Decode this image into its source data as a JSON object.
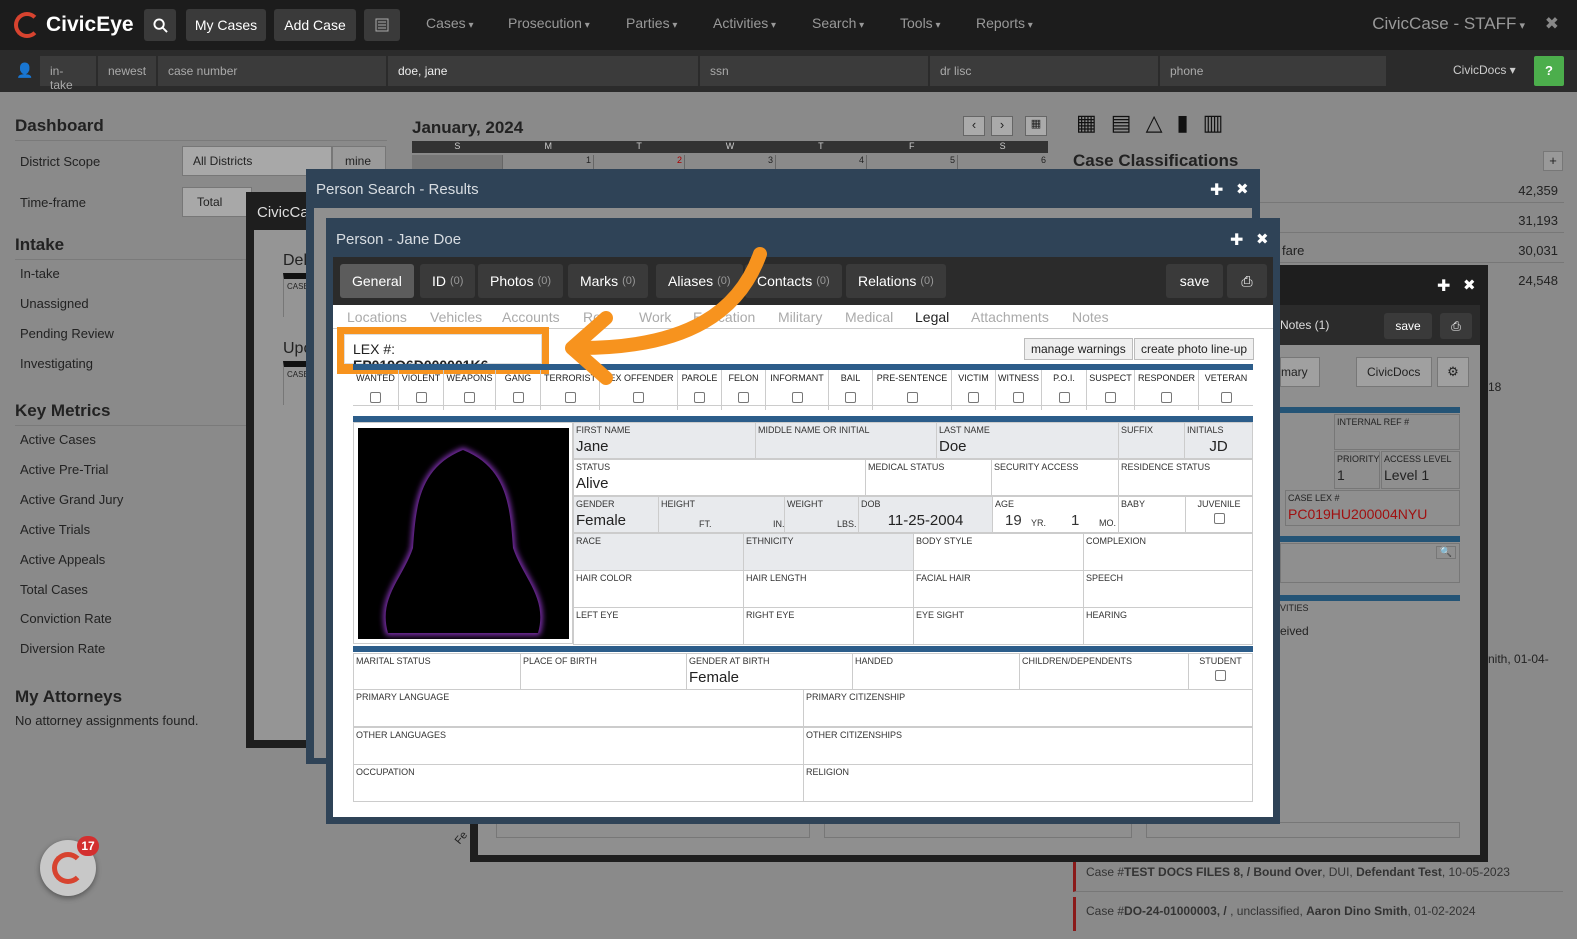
{
  "app": {
    "logo_text": "CivicEye",
    "name": "CivicCase - STAFF"
  },
  "toolbar": {
    "my_cases": "My Cases",
    "add_case": "Add Case"
  },
  "nav": [
    "Cases",
    "Prosecution",
    "Parties",
    "Activities",
    "Search",
    "Tools",
    "Reports"
  ],
  "searchbar": {
    "intake": "in-take",
    "newest": "newest",
    "case_number": "case number",
    "name": "doe, jane",
    "ssn": "ssn",
    "dr": "dr lisc",
    "phone": "phone",
    "civicdocs": "CivicDocs",
    "help": "?"
  },
  "dashboard": {
    "title": "Dashboard",
    "district_label": "District Scope",
    "district_value": "All Districts",
    "mine": "mine",
    "timeframe_label": "Time-frame",
    "timeframe_value": "Total",
    "intake_title": "Intake",
    "intake_items": [
      "In-take",
      "Unassigned",
      "Pending Review",
      "Investigating"
    ],
    "metrics_title": "Key Metrics",
    "metrics_items": [
      "Active Cases",
      "Active Pre-Trial",
      "Active Grand Jury",
      "Active Trials",
      "Active Appeals",
      "Total Cases",
      "Conviction Rate",
      "Diversion Rate"
    ],
    "attorneys_title": "My Attorneys",
    "attorneys_empty": "No attorney assignments found."
  },
  "calendar": {
    "title": "January, 2024",
    "days": [
      "S",
      "M",
      "T",
      "W",
      "T",
      "F",
      "S"
    ],
    "dates": [
      "",
      "1",
      "2",
      "3",
      "4",
      "5",
      "6"
    ]
  },
  "classifications": {
    "title": "Case Classifications",
    "rows": [
      {
        "label": "",
        "value": "42,359"
      },
      {
        "label": "",
        "value": "31,193"
      },
      {
        "label": "fare",
        "value": "30,031"
      },
      {
        "label": "",
        "value": "24,548"
      }
    ]
  },
  "case_list": [
    {
      "prefix": "Case #",
      "bold1": "TEST DOCS FILES 8, / Bound Over",
      "mid": ", DUI, ",
      "bold2": "Defendant Test",
      "tail": ", 10-05-2023"
    },
    {
      "prefix": "Case #",
      "bold1": "DO-24-01000003, /",
      "mid": " , unclassified, ",
      "bold2": "Aaron Dino Smith",
      "tail": ", 01-02-2024"
    }
  ],
  "bg_modal": {
    "title": "CivicCa",
    "del": "Del",
    "upc": "Upc",
    "case": "CASE",
    "notes_tab": "Notes (1)",
    "save": "save",
    "summary": "mary",
    "civicdocs": "CivicDocs",
    "internal_ref": "INTERNAL REF #",
    "priority": "PRIORITY",
    "priority_val": "1",
    "access": "ACCESS LEVEL",
    "access_val": "Level 1",
    "case_lex": "CASE LEX #",
    "case_lex_val": "PC019HU200004NYU",
    "activities": "VITIES",
    "received": "eived",
    "side1": "18",
    "side2": "nith, 01-04-",
    "side3": "Fe"
  },
  "search_results": {
    "title": "Person Search - Results"
  },
  "person": {
    "title": "Person - Jane Doe",
    "tabs": [
      {
        "label": "General",
        "count": ""
      },
      {
        "label": "ID",
        "count": "(0)"
      },
      {
        "label": "Photos",
        "count": "(0)"
      },
      {
        "label": "Marks",
        "count": "(0)"
      },
      {
        "label": "Aliases",
        "count": "(0)"
      },
      {
        "label": "Contacts",
        "count": "(0)"
      },
      {
        "label": "Relations",
        "count": "(0)"
      }
    ],
    "save": "save",
    "subtabs": [
      "Locations",
      "Vehicles",
      "Accounts",
      "Ro",
      "Work",
      "Education",
      "Military",
      "Medical",
      "Legal",
      "Attachments",
      "Notes"
    ],
    "lex_label": "LEX #:",
    "lex_value": "EP019O6D000001K6",
    "manage_warnings": "manage warnings",
    "photo_lineup": "create photo line-up",
    "flags": [
      "WANTED",
      "VIOLENT",
      "WEAPONS",
      "GANG",
      "TERRORIST",
      "SEX OFFENDER",
      "PAROLE",
      "FELON",
      "INFORMANT",
      "BAIL",
      "PRE-SENTENCE",
      "VICTIM",
      "WITNESS",
      "P.O.I.",
      "SUSPECT",
      "RESPONDER",
      "VETERAN"
    ],
    "fields": {
      "first_name_label": "FIRST NAME",
      "first_name": "Jane",
      "middle_label": "MIDDLE NAME OR INITIAL",
      "last_name_label": "LAST NAME",
      "last_name": "Doe",
      "suffix_label": "SUFFIX",
      "initials_label": "INITIALS",
      "initials": "JD",
      "status_label": "STATUS",
      "status": "Alive",
      "medical_label": "MEDICAL STATUS",
      "security_label": "SECURITY ACCESS",
      "residence_label": "RESIDENCE STATUS",
      "gender_label": "GENDER",
      "gender": "Female",
      "height_label": "HEIGHT",
      "ft": "FT.",
      "in": "IN.",
      "weight_label": "WEIGHT",
      "lbs": "LBS.",
      "dob_label": "DOB",
      "dob": "11-25-2004",
      "age_label": "AGE",
      "age_yr": "19",
      "yr": "YR.",
      "age_mo": "1",
      "mo": "MO.",
      "baby_label": "BABY",
      "juvenile_label": "JUVENILE",
      "race_label": "RACE",
      "ethnicity_label": "ETHNICITY",
      "body_label": "BODY STYLE",
      "complexion_label": "COMPLEXION",
      "hair_color_label": "HAIR COLOR",
      "hair_length_label": "HAIR LENGTH",
      "facial_hair_label": "FACIAL HAIR",
      "speech_label": "SPEECH",
      "left_eye_label": "LEFT EYE",
      "right_eye_label": "RIGHT EYE",
      "eye_sight_label": "EYE SIGHT",
      "hearing_label": "HEARING",
      "marital_label": "MARITAL STATUS",
      "birthplace_label": "PLACE OF BIRTH",
      "gender_birth_label": "GENDER AT BIRTH",
      "gender_birth": "Female",
      "handed_label": "HANDED",
      "children_label": "CHILDREN/DEPENDENTS",
      "student_label": "STUDENT",
      "primary_lang_label": "PRIMARY LANGUAGE",
      "primary_cit_label": "PRIMARY CITIZENSHIP",
      "other_lang_label": "OTHER LANGUAGES",
      "other_cit_label": "OTHER CITIZENSHIPS",
      "occupation_label": "OCCUPATION",
      "religion_label": "RELIGION"
    }
  },
  "notification": {
    "count": "17"
  },
  "colors": {
    "accent_orange": "#f7931e",
    "modal_header": "#2c3e50",
    "blue_bar": "#2c5d8a",
    "brand_red": "#d7432f"
  }
}
